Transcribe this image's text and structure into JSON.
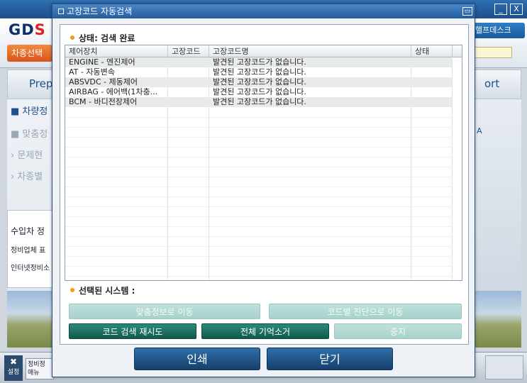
{
  "app": {
    "logo_main": "GD",
    "logo_accent": "S",
    "left_pill": "차종선택",
    "right_pill": "헬프데스크",
    "nav_left": "Prep",
    "nav_right": "ort",
    "side_items": [
      "차량정",
      "맞춤정",
      "문제현",
      "차종별"
    ],
    "side_box_title": "수입차 정",
    "side_box_line1": "정비업체 표",
    "side_box_line2": "인터넷정비소",
    "right_panel_text": "A",
    "taskbar_settings": "설정",
    "taskbar_button": "정비정 매뉴",
    "window_minimize": "_",
    "window_close": "X"
  },
  "dialog": {
    "title": "고장코드 자동검색",
    "minimize": "▭",
    "status_label": "상태: 검색 완료",
    "columns": [
      "제어장치",
      "고장코드",
      "고장코드명",
      "상태"
    ],
    "rows": [
      {
        "device": "ENGINE - 엔진제어",
        "code": "",
        "name": "발견된 고장코드가 없습니다.",
        "state": ""
      },
      {
        "device": "AT - 자동변속",
        "code": "",
        "name": "발견된 고장코드가 없습니다.",
        "state": ""
      },
      {
        "device": "ABSVDC - 제동제어",
        "code": "",
        "name": "발견된 고장코드가 없습니다.",
        "state": ""
      },
      {
        "device": "AIRBAG - 에어백(1차충...",
        "code": "",
        "name": "발견된 고장코드가 없습니다.",
        "state": ""
      },
      {
        "device": "BCM - 바디전장제어",
        "code": "",
        "name": "발견된 고장코드가 없습니다.",
        "state": ""
      }
    ],
    "selected_label": "선택된 시스템 :",
    "btn_goto_custom": "맞춤정보로 이동",
    "btn_goto_code": "코드별 진단으로 이동",
    "btn_retry": "코드 검색 재시도",
    "btn_clear_all": "전체 기억소거",
    "btn_stop": "중지",
    "btn_print": "인쇄",
    "btn_close": "닫기"
  },
  "colors": {
    "dialog_title": "#255d9c",
    "active_button": "#13594d",
    "disabled_button": "#a8d2cc",
    "bottom_button": "#163f6c",
    "status_dot": "#f39a1e"
  }
}
